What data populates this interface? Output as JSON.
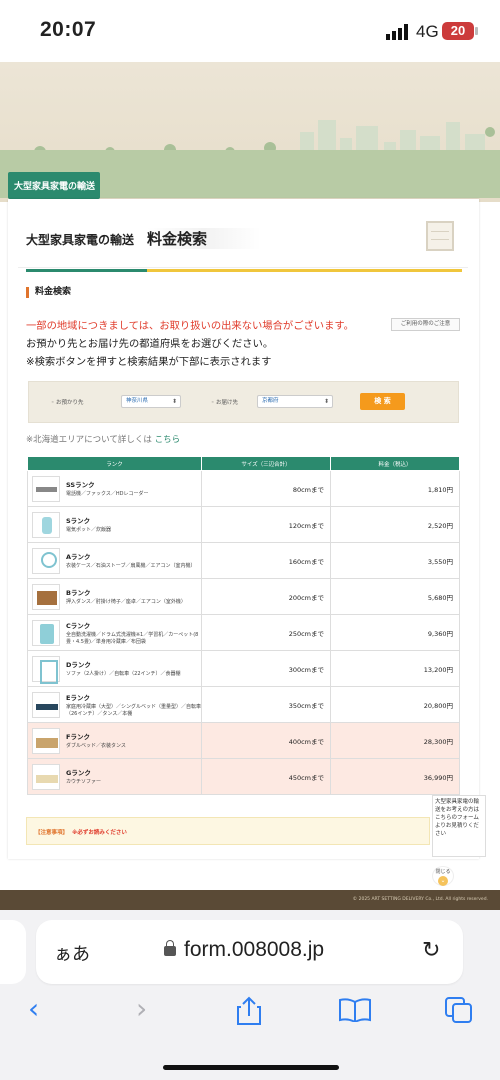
{
  "status_bar": {
    "time": "20:07",
    "network": "4G",
    "battery": "20"
  },
  "breadcrumb_tab": "大型家具家電の輸送",
  "page_head": {
    "category": "大型家具家電の輸送",
    "title": "料金検索"
  },
  "section_title": "料金検索",
  "warning": "一部の地域につきましては、お取り扱いの出来ない場合がございます。",
  "notice_button": "ご利用の際のご注意",
  "info_lines": [
    "お預かり先とお届け先の都道府県をお選びください。",
    "※検索ボタンを押すと検索結果が下部に表示されます"
  ],
  "search": {
    "from_label": "お預かり先",
    "from_value": "神奈川県",
    "to_label": "お届け先",
    "to_value": "京都府",
    "button": "検 索"
  },
  "hokkaido_note": {
    "text": "※北海道エリアについて詳しくは",
    "link": "こちら"
  },
  "table": {
    "headers": [
      "ランク",
      "サイズ（三辺合計）",
      "料金（税込）"
    ],
    "rows": [
      {
        "rank": "SSランク",
        "desc": "電話機／ファックス／HDレコーダー",
        "size": "80cmまで",
        "fee": "1,810円",
        "icon": "recorder-icon"
      },
      {
        "rank": "Sランク",
        "desc": "電気ポット／炊飯器",
        "size": "120cmまで",
        "fee": "2,520円",
        "icon": "pot-icon"
      },
      {
        "rank": "Aランク",
        "desc": "衣装ケース／石油ストーブ／扇風機／エアコン（室内機）",
        "size": "160cmまで",
        "fee": "3,550円",
        "icon": "fan-icon"
      },
      {
        "rank": "Bランク",
        "desc": "押入ダンス／肘掛け椅子／座卓／エアコン（室外機）",
        "size": "200cmまで",
        "fee": "5,680円",
        "icon": "chest-icon"
      },
      {
        "rank": "Cランク",
        "desc": "全自動洗濯機／ドラム式洗濯機※1／学習机／カーペット(8畳・4.5畳)／単身用冷蔵庫／布団袋",
        "size": "250cmまで",
        "fee": "9,360円",
        "icon": "washer-icon"
      },
      {
        "rank": "Dランク",
        "desc": "ソファ（2人掛け）／自転車（22インチ）／食器棚",
        "size": "300cmまで",
        "fee": "13,200円",
        "icon": "cabinet-icon"
      },
      {
        "rank": "Eランク",
        "desc": "家庭用冷蔵庫（大型）／シングルベッド（重量型）／自転車（26インチ）／タンス／本棚",
        "size": "350cmまで",
        "fee": "20,800円",
        "icon": "bed-icon"
      },
      {
        "rank": "Fランク",
        "desc": "ダブルベッド／衣装タンス",
        "size": "400cmまで",
        "fee": "28,300円",
        "icon": "double-bed-icon"
      },
      {
        "rank": "Gランク",
        "desc": "カウチソファー",
        "size": "450cmまで",
        "fee": "36,990円",
        "icon": "couch-icon"
      }
    ]
  },
  "caution": {
    "label": "【注意事項】",
    "text": "※必ずお読みください"
  },
  "side_box": "大型家具家電の輸送をお考えの方はこちらのフォームよりお見積りください",
  "close_label": "閉じる",
  "footer_copy": "© 2025 ART SETTING DELIVERY Co., Ltd. All rights reserved.",
  "browser": {
    "aa": "ぁあ",
    "url": "form.008008.jp"
  }
}
